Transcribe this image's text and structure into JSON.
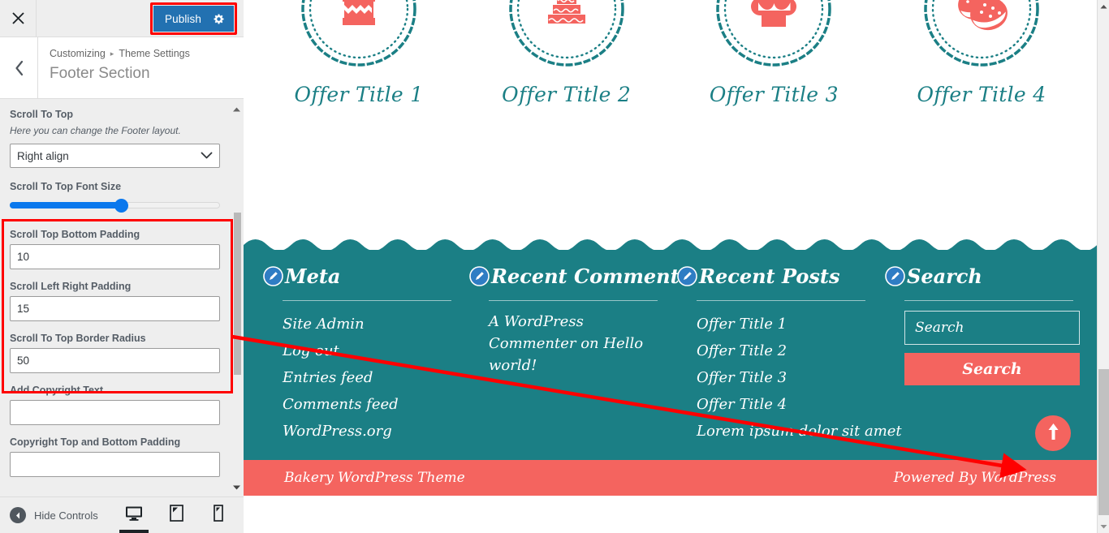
{
  "customizer": {
    "close_icon": "close-icon",
    "publish_label": "Publish",
    "publish_gear_icon": "gear-icon",
    "back_icon": "chevron-left-icon",
    "breadcrumb_root": "Customizing",
    "breadcrumb_sep": "▸",
    "breadcrumb_parent": "Theme Settings",
    "section_title": "Footer Section",
    "accent_blue": "#2271b1",
    "highlight_red": "#ff0000",
    "controls": [
      {
        "label": "Scroll To Top",
        "description": "Here you can change the Footer layout.",
        "type": "select",
        "value": "Right align"
      },
      {
        "label": "Scroll To Top Font Size",
        "type": "slider",
        "percent": 53
      },
      {
        "label": "Scroll Top Bottom Padding",
        "type": "text",
        "value": "10"
      },
      {
        "label": "Scroll Left Right Padding",
        "type": "text",
        "value": "15"
      },
      {
        "label": "Scroll To Top Border Radius",
        "type": "text",
        "value": "50"
      },
      {
        "label": "Add Copyright Text",
        "type": "text",
        "value": ""
      },
      {
        "label": "Copyright Top and Bottom Padding",
        "type": "text",
        "value": ""
      }
    ],
    "footer_bar": {
      "hide_controls_label": "Hide Controls",
      "hide_controls_icon": "chevron-left-circle-icon",
      "devices": [
        {
          "name": "desktop",
          "icon": "desktop-icon",
          "active": true
        },
        {
          "name": "tablet",
          "icon": "tablet-icon",
          "active": false
        },
        {
          "name": "mobile",
          "icon": "mobile-icon",
          "active": false
        }
      ]
    }
  },
  "preview": {
    "theme_teal": "#1b7f85",
    "theme_coral": "#f4645f",
    "offers": [
      {
        "title": "Offer Title 1",
        "icon": "cake-slice-icon"
      },
      {
        "title": "Offer Title 2",
        "icon": "tiered-cake-icon"
      },
      {
        "title": "Offer Title 3",
        "icon": "cupcake-candle-icon"
      },
      {
        "title": "Offer Title 4",
        "icon": "cookies-icon"
      }
    ],
    "widgets": [
      {
        "title": "Meta",
        "edit_icon": "pencil-edit-icon",
        "type": "list",
        "items": [
          "Site Admin",
          "Log out",
          "Entries feed",
          "Comments feed",
          "WordPress.org"
        ]
      },
      {
        "title": "Recent Comments",
        "edit_icon": "pencil-edit-icon",
        "type": "text",
        "text": "A WordPress Commenter on Hello world!"
      },
      {
        "title": "Recent Posts",
        "edit_icon": "pencil-edit-icon",
        "type": "list",
        "items": [
          "Offer Title 1",
          "Offer Title 2",
          "Offer Title 3",
          "Offer Title 4",
          "Lorem ipsum dolor sit amet"
        ]
      },
      {
        "title": "Search",
        "edit_icon": "pencil-edit-icon",
        "type": "search",
        "search_placeholder": "Search",
        "search_button_label": "Search"
      }
    ],
    "scroll_top_icon": "arrow-up-icon",
    "copyright_left": "Bakery WordPress Theme",
    "copyright_right": "Powered By WordPress"
  }
}
